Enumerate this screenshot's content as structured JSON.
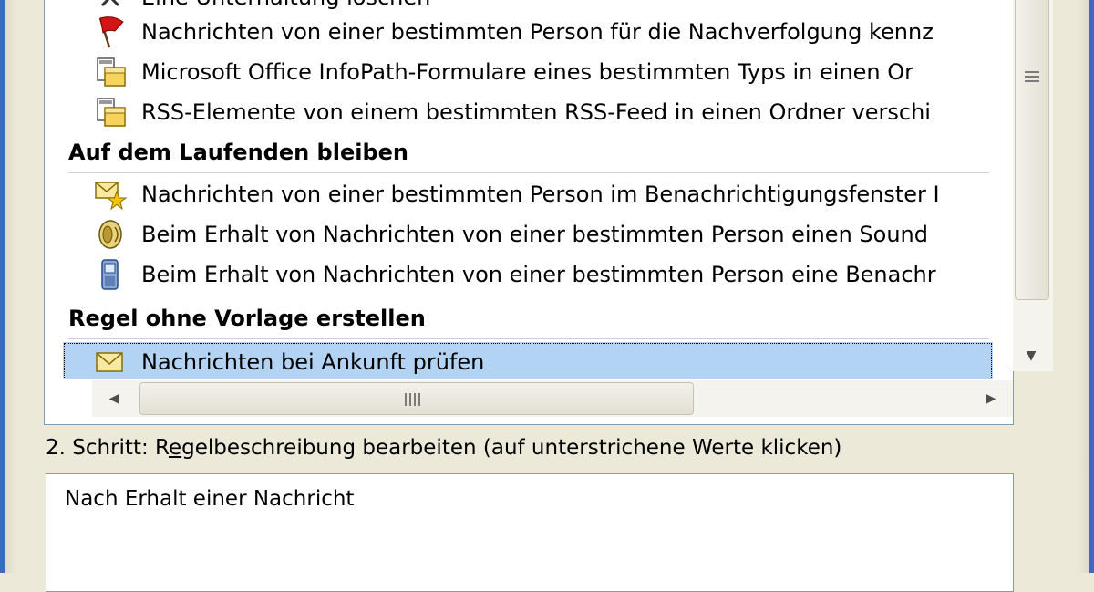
{
  "rules_list": {
    "rows": [
      {
        "type": "item",
        "icon": "delete-icon",
        "label": "Eine Unterhaltung löschen"
      },
      {
        "type": "item",
        "icon": "red-flag-icon",
        "label": "Nachrichten von einer bestimmten Person für die Nachverfolgung kennz"
      },
      {
        "type": "item",
        "icon": "move-to-folder-icon",
        "label": "Microsoft Office InfoPath-Formulare eines bestimmten Typs in einen Or"
      },
      {
        "type": "item",
        "icon": "move-to-folder-icon",
        "label": "RSS-Elemente von einem bestimmten RSS-Feed in einen Ordner verschi"
      },
      {
        "type": "header",
        "label": "Auf dem Laufenden bleiben"
      },
      {
        "type": "item",
        "icon": "envelope-star-icon",
        "label": "Nachrichten von einer bestimmten Person im Benachrichtigungsfenster I"
      },
      {
        "type": "item",
        "icon": "speaker-icon",
        "label": "Beim Erhalt von Nachrichten von einer bestimmten Person einen Sound"
      },
      {
        "type": "item",
        "icon": "mobile-phone-icon",
        "label": "Beim Erhalt von Nachrichten von einer bestimmten Person eine Benachr"
      },
      {
        "type": "header",
        "label": "Regel ohne Vorlage erstellen"
      },
      {
        "type": "item",
        "icon": "envelope-icon",
        "label": "Nachrichten bei Ankunft prüfen",
        "selected": true
      }
    ]
  },
  "step2": {
    "label_pre": "2. Schritt: R",
    "label_access": "e",
    "label_post": "gelbeschreibung bearbeiten (auf unterstrichene Werte klicken)",
    "description": "Nach Erhalt einer Nachricht"
  }
}
